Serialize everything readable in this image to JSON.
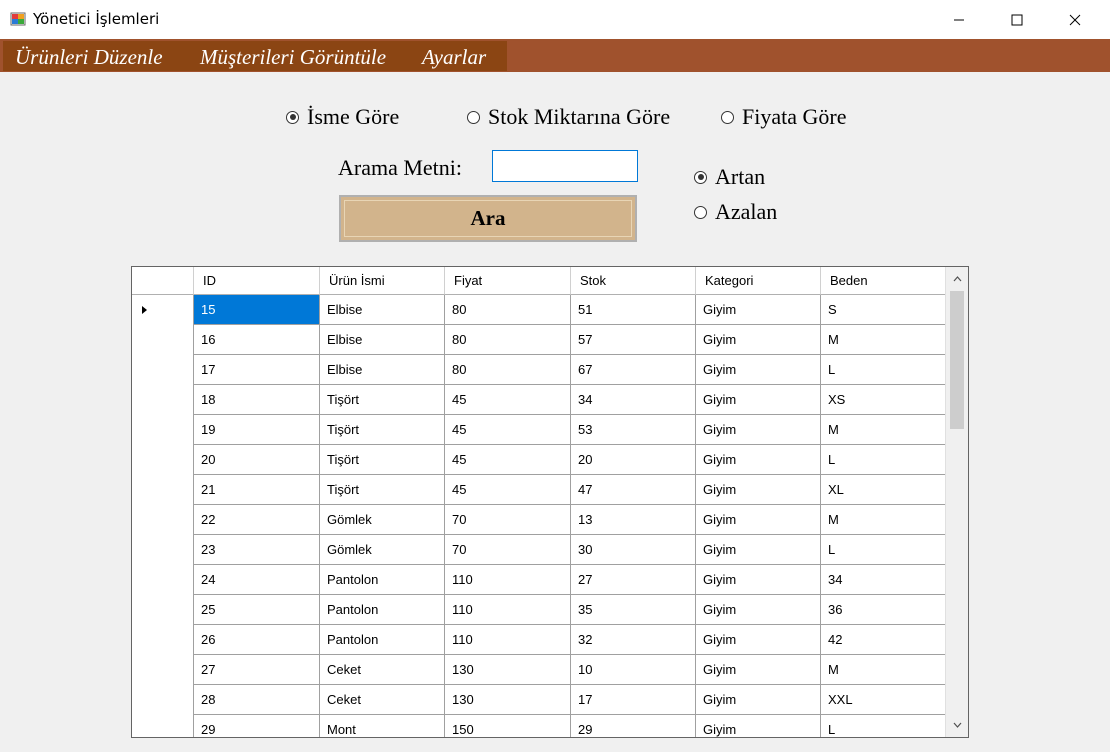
{
  "window": {
    "title": "Yönetici İşlemleri"
  },
  "menu": {
    "items": [
      "Ürünleri Düzenle",
      "Müşterileri Görüntüle",
      "Ayarlar"
    ]
  },
  "search_by": {
    "options": [
      "İsme Göre",
      "Stok Miktarına Göre",
      "Fiyata Göre"
    ],
    "selected": "İsme Göre"
  },
  "search": {
    "label": "Arama Metni:",
    "value": "",
    "button_label": "Ara"
  },
  "order": {
    "options": [
      "Artan",
      "Azalan"
    ],
    "selected": "Artan"
  },
  "grid": {
    "columns": [
      "ID",
      "Ürün İsmi",
      "Fiyat",
      "Stok",
      "Kategori",
      "Beden"
    ],
    "rows": [
      [
        "15",
        "Elbise",
        "80",
        "51",
        "Giyim",
        "S"
      ],
      [
        "16",
        "Elbise",
        "80",
        "57",
        "Giyim",
        "M"
      ],
      [
        "17",
        "Elbise",
        "80",
        "67",
        "Giyim",
        "L"
      ],
      [
        "18",
        "Tişört",
        "45",
        "34",
        "Giyim",
        "XS"
      ],
      [
        "19",
        "Tişört",
        "45",
        "53",
        "Giyim",
        "M"
      ],
      [
        "20",
        "Tişört",
        "45",
        "20",
        "Giyim",
        "L"
      ],
      [
        "21",
        "Tişört",
        "45",
        "47",
        "Giyim",
        "XL"
      ],
      [
        "22",
        "Gömlek",
        "70",
        "13",
        "Giyim",
        "M"
      ],
      [
        "23",
        "Gömlek",
        "70",
        "30",
        "Giyim",
        "L"
      ],
      [
        "24",
        "Pantolon",
        "110",
        "27",
        "Giyim",
        "34"
      ],
      [
        "25",
        "Pantolon",
        "110",
        "35",
        "Giyim",
        "36"
      ],
      [
        "26",
        "Pantolon",
        "110",
        "32",
        "Giyim",
        "42"
      ],
      [
        "27",
        "Ceket",
        "130",
        "10",
        "Giyim",
        "M"
      ],
      [
        "28",
        "Ceket",
        "130",
        "17",
        "Giyim",
        "XXL"
      ],
      [
        "29",
        "Mont",
        "150",
        "29",
        "Giyim",
        "L"
      ]
    ],
    "selected_row": 0
  },
  "colors": {
    "menubar": "#a0522d",
    "menu_strip": "#8b4513",
    "search_button": "#d2b48c",
    "selection": "#0078d7"
  }
}
